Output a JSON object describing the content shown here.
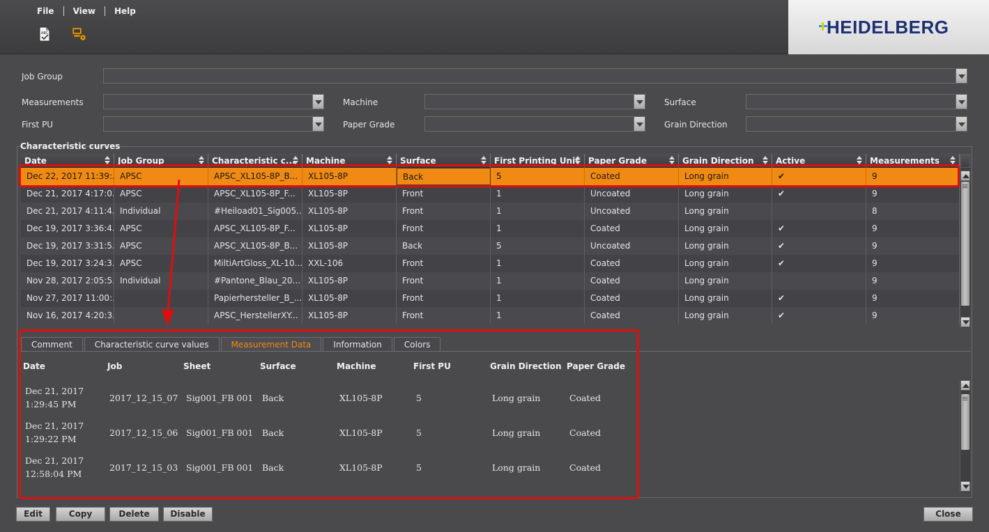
{
  "menu": {
    "file": "File",
    "view": "View",
    "help": "Help"
  },
  "toolbar": {
    "icons": [
      "spellcheck-doc-icon",
      "computer-settings-icon"
    ]
  },
  "brand": {
    "logo_text": "HEIDELBERG",
    "colors": {
      "navy": "#1b2f72",
      "yellow": "#f3c400",
      "cyan": "#19a6e0"
    }
  },
  "filters": {
    "job_group_label": "Job Group",
    "measurements_label": "Measurements",
    "machine_label": "Machine",
    "surface_label": "Surface",
    "first_pu_label": "First PU",
    "paper_grade_label": "Paper Grade",
    "grain_direction_label": "Grain Direction"
  },
  "curves": {
    "group_title": "Characteristic curves",
    "columns": [
      "Date",
      "Job Group",
      "Characteristic c...",
      "Machine",
      "Surface",
      "First Printing Unit",
      "Paper Grade",
      "Grain Direction",
      "Active",
      "Measurements"
    ],
    "rows": [
      [
        "Dec 22, 2017  11:39:...",
        "APSC",
        "APSC_XL105-8P_B...",
        "XL105-8P",
        "Back",
        "5",
        "Coated",
        "Long grain",
        "✔",
        "9"
      ],
      [
        "Dec 21, 2017  4:17:0...",
        "APSC",
        "APSC_XL105-8P_F...",
        "XL105-8P",
        "Front",
        "1",
        "Uncoated",
        "Long grain",
        "✔",
        "9"
      ],
      [
        "Dec 21, 2017  4:11:4...",
        "Individual",
        "#Heiload01_Sig005...",
        "XL105-8P",
        "Front",
        "1",
        "Uncoated",
        "Long grain",
        "",
        "8"
      ],
      [
        "Dec 19, 2017  3:36:4...",
        "APSC",
        "APSC_XL105-8P_F...",
        "XL105-8P",
        "Front",
        "1",
        "Coated",
        "Long grain",
        "✔",
        "9"
      ],
      [
        "Dec 19, 2017  3:31:5...",
        "APSC",
        "APSC_XL105-8P_B...",
        "XL105-8P",
        "Back",
        "5",
        "Uncoated",
        "Long grain",
        "✔",
        "9"
      ],
      [
        "Dec 19, 2017  3:24:3...",
        "APSC",
        "MiltiArtGloss_XL-10...",
        "XXL-106",
        "Front",
        "1",
        "Coated",
        "Long grain",
        "✔",
        "9"
      ],
      [
        "Nov 28, 2017  2:05:5...",
        "Individual",
        "#Pantone_Blau_20...",
        "XL105-8P",
        "Front",
        "1",
        "Coated",
        "Long grain",
        "",
        "9"
      ],
      [
        "Nov 27, 2017  11:00:...",
        "",
        "Papierhersteller_B_...",
        "XL105-8P",
        "Front",
        "1",
        "Coated",
        "Long grain",
        "✔",
        "9"
      ],
      [
        "Nov 16, 2017  4:20:3...",
        "",
        "APSC_HerstellerXY...",
        "XL105-8P",
        "Front",
        "1",
        "Coated",
        "Long grain",
        "✔",
        "9"
      ]
    ],
    "selected_row": 0
  },
  "tabs": [
    "Comment",
    "Characteristic curve values",
    "Measurement Data",
    "Information",
    "Colors"
  ],
  "active_tab": 2,
  "measurement_data": {
    "columns": [
      "Date",
      "Job",
      "Sheet",
      "Surface",
      "Machine",
      "First PU",
      "Grain Direction",
      "Paper Grade"
    ],
    "rows": [
      {
        "date1": "Dec 21, 2017",
        "date2": "1:29:45 PM",
        "job": "2017_12_15_07",
        "sheet": "Sig001_FB 001",
        "surface": "Back",
        "machine": "XL105-8P",
        "first_pu": "5",
        "grain": "Long grain",
        "paper": "Coated"
      },
      {
        "date1": "Dec 21, 2017",
        "date2": "1:29:22 PM",
        "job": "2017_12_15_06",
        "sheet": "Sig001_FB 001",
        "surface": "Back",
        "machine": "XL105-8P",
        "first_pu": "5",
        "grain": "Long grain",
        "paper": "Coated"
      },
      {
        "date1": "Dec 21, 2017",
        "date2": "12:58:04 PM",
        "job": "2017_12_15_03",
        "sheet": "Sig001_FB 001",
        "surface": "Back",
        "machine": "XL105-8P",
        "first_pu": "5",
        "grain": "Long grain",
        "paper": "Coated"
      }
    ]
  },
  "buttons": {
    "edit": "Edit",
    "copy": "Copy",
    "delete": "Delete",
    "disable": "Disable",
    "close": "Close"
  },
  "colors": {
    "selection": "#f08a12",
    "annotation": "#e00d0d",
    "active_tab": "#f08a12"
  }
}
